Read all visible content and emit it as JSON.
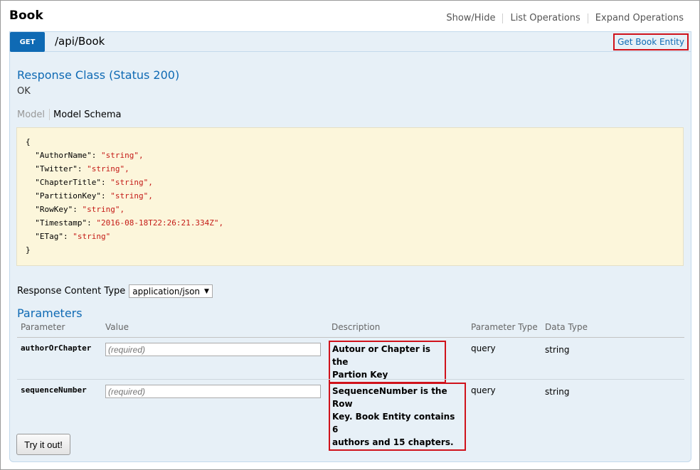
{
  "resource": {
    "title": "Book",
    "links": [
      "Show/Hide",
      "List Operations",
      "Expand Operations"
    ]
  },
  "operation": {
    "method": "GET",
    "path": "/api/Book",
    "summary": "Get Book Entity",
    "response_class_heading": "Response Class (Status 200)",
    "response_status_text": "OK",
    "tabs": {
      "model": "Model",
      "model_schema": "Model Schema"
    },
    "schema_lines": [
      [
        "{",
        ""
      ],
      [
        "  \"AuthorName\": ",
        "\"string\","
      ],
      [
        "  \"Twitter\": ",
        "\"string\","
      ],
      [
        "  \"ChapterTitle\": ",
        "\"string\","
      ],
      [
        "  \"PartitionKey\": ",
        "\"string\","
      ],
      [
        "  \"RowKey\": ",
        "\"string\","
      ],
      [
        "  \"Timestamp\": ",
        "\"2016-08-18T22:26:21.334Z\","
      ],
      [
        "  \"ETag\": ",
        "\"string\""
      ],
      [
        "}",
        ""
      ]
    ],
    "response_content_type_label": "Response Content Type",
    "response_content_type_value": "application/json",
    "parameters_heading": "Parameters",
    "param_headers": {
      "parameter": "Parameter",
      "value": "Value",
      "description": "Description",
      "parameter_type": "Parameter Type",
      "data_type": "Data Type"
    },
    "params": [
      {
        "name": "authorOrChapter",
        "placeholder": "(required)",
        "description_lines": [
          "Autour or Chapter is the",
          "Partion Key"
        ],
        "param_type": "query",
        "data_type": "string"
      },
      {
        "name": "sequenceNumber",
        "placeholder": "(required)",
        "description_lines": [
          "SequenceNumber is the Row",
          "Key. Book Entity contains 6",
          "authors and 15 chapters."
        ],
        "param_type": "query",
        "data_type": "string"
      }
    ],
    "try_button": "Try it out!"
  },
  "colors": {
    "get_method": "#0f6ab4",
    "highlight_border": "#d0121b",
    "operation_bg": "#e7f0f7",
    "schema_bg": "#fcf6db"
  }
}
